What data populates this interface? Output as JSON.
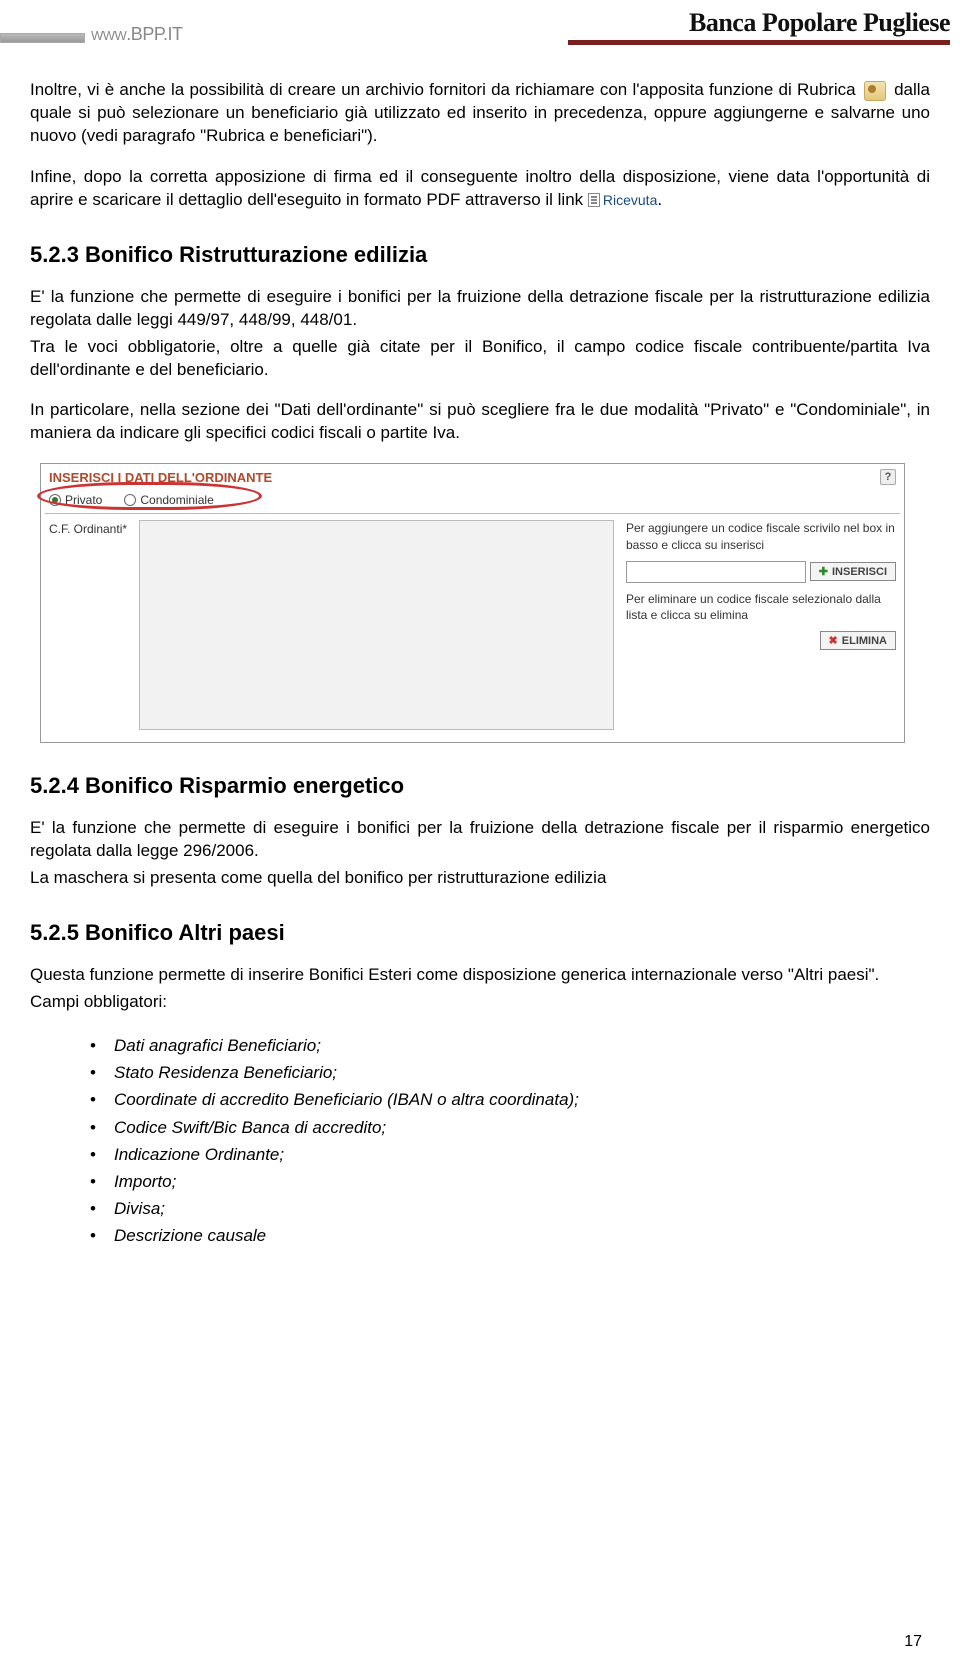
{
  "header": {
    "site_url": "www.BPP.IT",
    "bank_name": "Banca Popolare Pugliese"
  },
  "para1_prefix": "Inoltre, vi è anche la possibilità di creare un archivio fornitori da richiamare con l'apposita funzione di Rubrica",
  "para1_suffix": " dalla quale si può selezionare un beneficiario già utilizzato ed inserito in precedenza, oppure aggiungerne e salvarne uno nuovo (vedi paragrafo \"Rubrica e beneficiari\").",
  "para2_prefix": "Infine, dopo la corretta apposizione di firma ed il conseguente inoltro della disposizione, viene data l'opportunità di aprire e scaricare il dettaglio dell'eseguito in formato PDF attraverso il link ",
  "ricevuta_label": "Ricevuta",
  "para2_suffix": ".",
  "section_523": {
    "heading": "5.2.3 Bonifico Ristrutturazione edilizia",
    "p1": "E' la funzione che permette di eseguire i bonifici per la fruizione della detrazione fiscale per la ristrutturazione edilizia regolata dalle leggi 449/97, 448/99, 448/01.",
    "p2": "Tra le voci obbligatorie, oltre a quelle già citate per il Bonifico, il campo codice fiscale contribuente/partita Iva dell'ordinante e del beneficiario.",
    "p3": "In particolare, nella sezione dei \"Dati dell'ordinante\" si può scegliere fra le due modalità \"Privato\" e \"Condominiale\", in maniera da indicare gli specifici codici fiscali o partite Iva."
  },
  "panel": {
    "title": "INSERISCI I DATI DELL'ORDINANTE",
    "radio_privato": "Privato",
    "radio_condominiale": "Condominiale",
    "field_label": "C.F. Ordinanti*",
    "hint_add": "Per aggiungere un codice fiscale scrivilo nel box in basso e clicca su inserisci",
    "btn_insert": "INSERISCI",
    "hint_remove": "Per eliminare un codice fiscale selezionalo dalla lista e clicca su elimina",
    "btn_delete": "ELIMINA",
    "help": "?"
  },
  "section_524": {
    "heading": "5.2.4 Bonifico Risparmio energetico",
    "p1": "E' la funzione che permette di eseguire i bonifici per la fruizione della detrazione fiscale per il risparmio energetico regolata dalla legge 296/2006.",
    "p2": "La maschera si presenta come quella del bonifico per ristrutturazione edilizia"
  },
  "section_525": {
    "heading": "5.2.5 Bonifico Altri paesi",
    "p1": "Questa funzione permette di inserire Bonifici Esteri come disposizione generica internazionale verso \"Altri paesi\".",
    "p2": "Campi obbligatori:",
    "items": [
      "Dati anagrafici Beneficiario;",
      "Stato Residenza Beneficiario;",
      "Coordinate di accredito Beneficiario (IBAN o altra coordinata);",
      "Codice Swift/Bic Banca di accredito;",
      "Indicazione Ordinante;",
      "Importo;",
      "Divisa;",
      "Descrizione causale"
    ]
  },
  "page_number": "17"
}
